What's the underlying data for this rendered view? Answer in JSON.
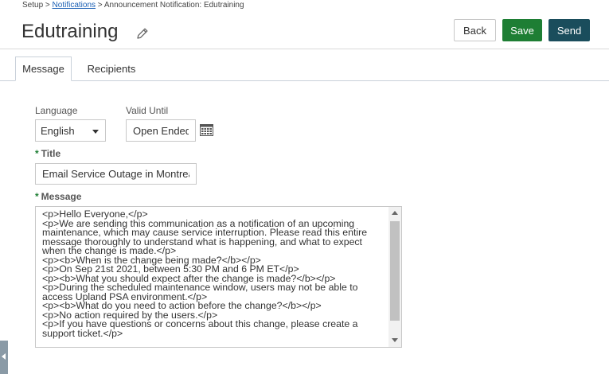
{
  "breadcrumb": {
    "root": "Setup",
    "sep1": " > ",
    "link": "Notifications",
    "sep2": " > ",
    "current": "Announcement Notification: Edutraining"
  },
  "page": {
    "title": "Edutraining",
    "edit_icon": "pencil-icon"
  },
  "actions": {
    "back": "Back",
    "save": "Save",
    "send": "Send"
  },
  "colors": {
    "save": "#1e7e34",
    "send": "#1a4d5c",
    "required": "#1e7e34"
  },
  "tabs": [
    {
      "label": "Message",
      "active": true
    },
    {
      "label": "Recipients",
      "active": false
    }
  ],
  "form": {
    "language_label": "Language",
    "language_value": "English",
    "valid_until_label": "Valid Until",
    "valid_until_value": "Open Ended",
    "calendar_icon": "calendar-icon",
    "required_mark": "*",
    "title_label": "Title",
    "title_value": "Email Service Outage in Montreal",
    "message_label": "Message",
    "message_value": "<p>Hello Everyone,</p>\n<p>We are sending this communication as a notification of an upcoming maintenance, which may cause service interruption. Please read this entire message thoroughly to understand what is happening, and what to expect when the change is made.</p>\n<p><b>When is the change being made?</b></p>\n<p>On Sep 21st 2021, between 5:30 PM and 6 PM ET</p>\n<p><b>What you should expect after the change is made?</b></p>\n<p>During the scheduled maintenance window, users may not be able to access Upland PSA environment.</p>\n<p><b>What do you need to action before the change?</b></p>\n<p>No action required by the users.</p>\n<p>If you have questions or concerns about this change, please create a support ticket.</p>"
  }
}
